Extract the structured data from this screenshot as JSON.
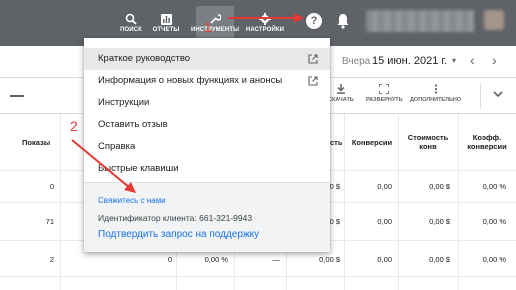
{
  "topnav": {
    "items": [
      {
        "label": "ПОИСК",
        "icon": "search-icon"
      },
      {
        "label": "ОТЧЕТЫ",
        "icon": "reports-icon"
      },
      {
        "label": "ИНСТРУМЕНТЫ",
        "icon": "tools-icon"
      },
      {
        "label": "НАСТРОЙКИ",
        "icon": "settings-icon"
      }
    ],
    "help_glyph": "?",
    "bell_icon": "bell-icon"
  },
  "date": {
    "prefix": "Вчера",
    "value": "15 июн. 2021 г.",
    "caret": "▾",
    "prev": "‹",
    "next": "›"
  },
  "toolbar": {
    "download_label": "СКАЧАТЬ",
    "expand_label": "РАЗВЕРНУТЬ",
    "more_label": "ДОПОЛНИТЕЛЬНО"
  },
  "table": {
    "headers": {
      "impressions": "Показы",
      "cost_partial": "сть",
      "conversions": "Конверсии",
      "cost_per_conv": "Стоимость конв",
      "conv_rate": "Коэфф. конверсии"
    },
    "rows": [
      {
        "impressions": "0",
        "cost": "0,00 $",
        "conversions": "0,00",
        "cost_per_conv": "0,00 $",
        "conv_rate": "0,00 %"
      },
      {
        "impressions": "71",
        "cost": "0,00 $",
        "conversions": "0,00",
        "cost_per_conv": "0,00 $",
        "conv_rate": "0,00 %"
      },
      {
        "impressions": "2",
        "clicks": "0",
        "ctr": "0,00 %",
        "cpc": "—",
        "cost": "0,00 $",
        "conversions": "0,00",
        "cost_per_conv": "0,00 $",
        "conv_rate": "0,00 %"
      }
    ]
  },
  "menu": {
    "items": [
      {
        "label": "Краткое руководство",
        "external": true
      },
      {
        "label": "Информация о новых функциях и анонсы",
        "external": true
      },
      {
        "label": "Инструкции",
        "external": false
      },
      {
        "label": "Оставить отзыв",
        "external": false
      },
      {
        "label": "Справка",
        "external": false
      },
      {
        "label": "Быстрые клавиши",
        "external": false
      }
    ],
    "contact_link": "Свяжитесь с нами",
    "client_id": "Идентификатор клиента: 661-321-9943",
    "support_link": "Подтвердить запрос на поддержку"
  },
  "annotations": {
    "one": "1",
    "two": "2",
    "color": "#e53935"
  }
}
